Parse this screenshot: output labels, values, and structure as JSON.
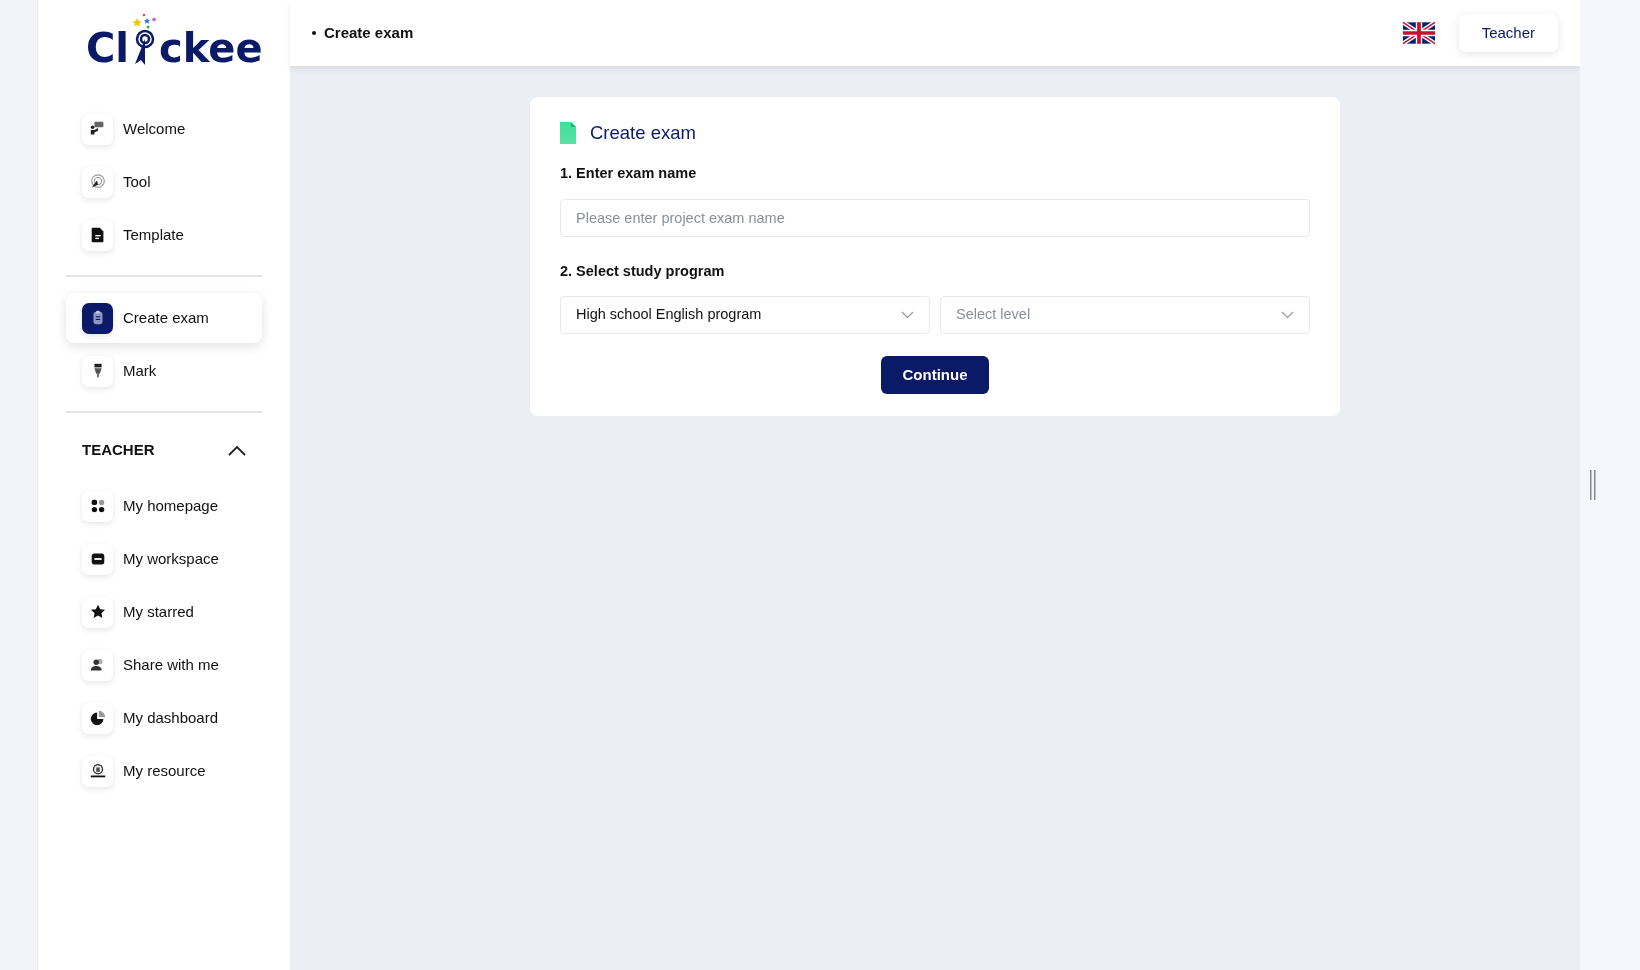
{
  "logo": {
    "text_before": "Cl",
    "text_after": "ckee"
  },
  "nav_groups": [
    {
      "items": [
        {
          "label": "Welcome",
          "selected": false
        },
        {
          "label": "Tool",
          "selected": false
        },
        {
          "label": "Template",
          "selected": false
        }
      ]
    },
    {
      "items": [
        {
          "label": "Create exam",
          "selected": true
        },
        {
          "label": "Mark",
          "selected": false
        }
      ]
    }
  ],
  "teacher_section": {
    "title": "TEACHER",
    "expanded": true,
    "items": [
      {
        "label": "My homepage",
        "selected": false
      },
      {
        "label": "My workspace",
        "selected": false
      },
      {
        "label": "My starred",
        "selected": false
      },
      {
        "label": "Share with me",
        "selected": false
      },
      {
        "label": "My dashboard",
        "selected": false
      },
      {
        "label": "My resource",
        "selected": false
      }
    ]
  },
  "header": {
    "breadcrumb": "Create exam",
    "role_button": "Teacher"
  },
  "form": {
    "title": "Create exam",
    "step_1": {
      "label": "1. Enter exam name",
      "placeholder": "Please enter project exam name"
    },
    "step_2": {
      "label": "2. Select study program",
      "program": {
        "value": "High school English program"
      },
      "level": {
        "placeholder": "Select level"
      }
    },
    "submit": "Continue"
  }
}
